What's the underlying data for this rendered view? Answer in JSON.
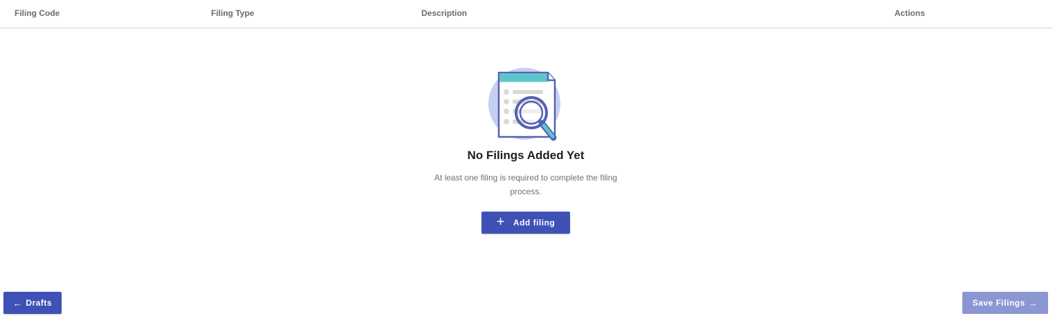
{
  "table": {
    "columns": [
      "Filing Code",
      "Filing Type",
      "Description",
      "Actions"
    ]
  },
  "empty_state": {
    "illustration": "document-search-icon",
    "title": "No Filings Added Yet",
    "subtitle": "At least one filing is required to complete the filing process.",
    "add_button_label": "Add filing",
    "add_button_icon": "plus-icon"
  },
  "footer": {
    "back_label": "Drafts",
    "back_icon": "arrow-left-icon",
    "save_label": "Save Filings",
    "save_icon": "arrow-right-icon"
  },
  "colors": {
    "primary": "#3f51b5",
    "primary_disabled": "#8c96d3",
    "illustration_bg": "#c5cff0",
    "illustration_accent": "#5bc6cc",
    "illustration_stroke": "#5561b4"
  }
}
